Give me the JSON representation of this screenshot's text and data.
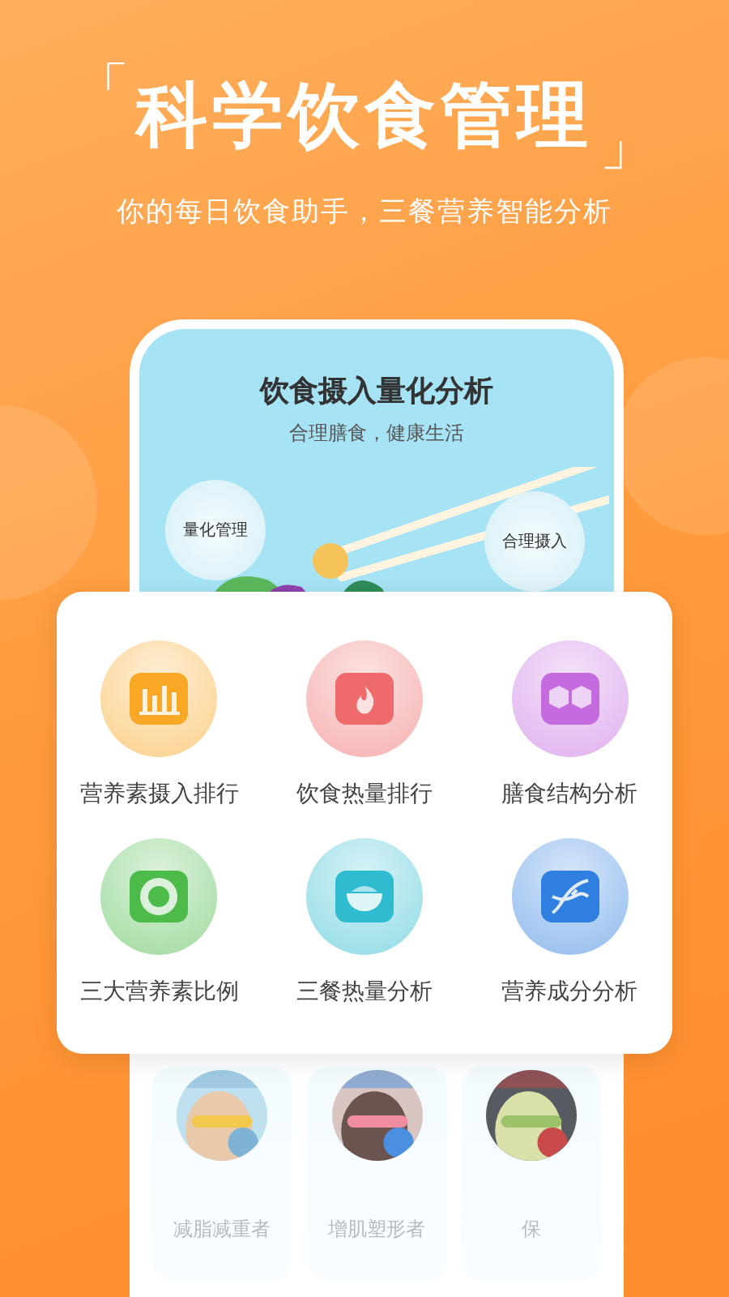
{
  "headline": {
    "open_bracket": "「",
    "title": "科学饮食管理",
    "close_bracket": "」",
    "subtitle": "你的每日饮食助手，三餐营养智能分析"
  },
  "phone": {
    "banner": {
      "title": "饮食摄入量化分析",
      "subtitle": "合理膳食，健康生活",
      "bubbles": [
        "量化管理",
        "合理摄入"
      ]
    },
    "users": [
      {
        "label": "减脂减重者",
        "kind": "picture"
      },
      {
        "label": "增肌塑形者",
        "kind": "picture"
      },
      {
        "label": "保",
        "kind": "picture"
      }
    ]
  },
  "features": [
    {
      "label": "营养素摄入排行",
      "kind": "chart",
      "color": "#f9a825"
    },
    {
      "label": "饮食热量排行",
      "kind": "fire",
      "color": "#ef6b6b"
    },
    {
      "label": "膳食结构分析",
      "kind": "hexagons",
      "color": "#c46be0"
    },
    {
      "label": "三大营养素比例",
      "kind": "ring",
      "color": "#4cbb4a"
    },
    {
      "label": "三餐热量分析",
      "kind": "bowl",
      "color": "#2fbcd0"
    },
    {
      "label": "营养成分分析",
      "kind": "dna",
      "color": "#2f7fe0"
    }
  ]
}
